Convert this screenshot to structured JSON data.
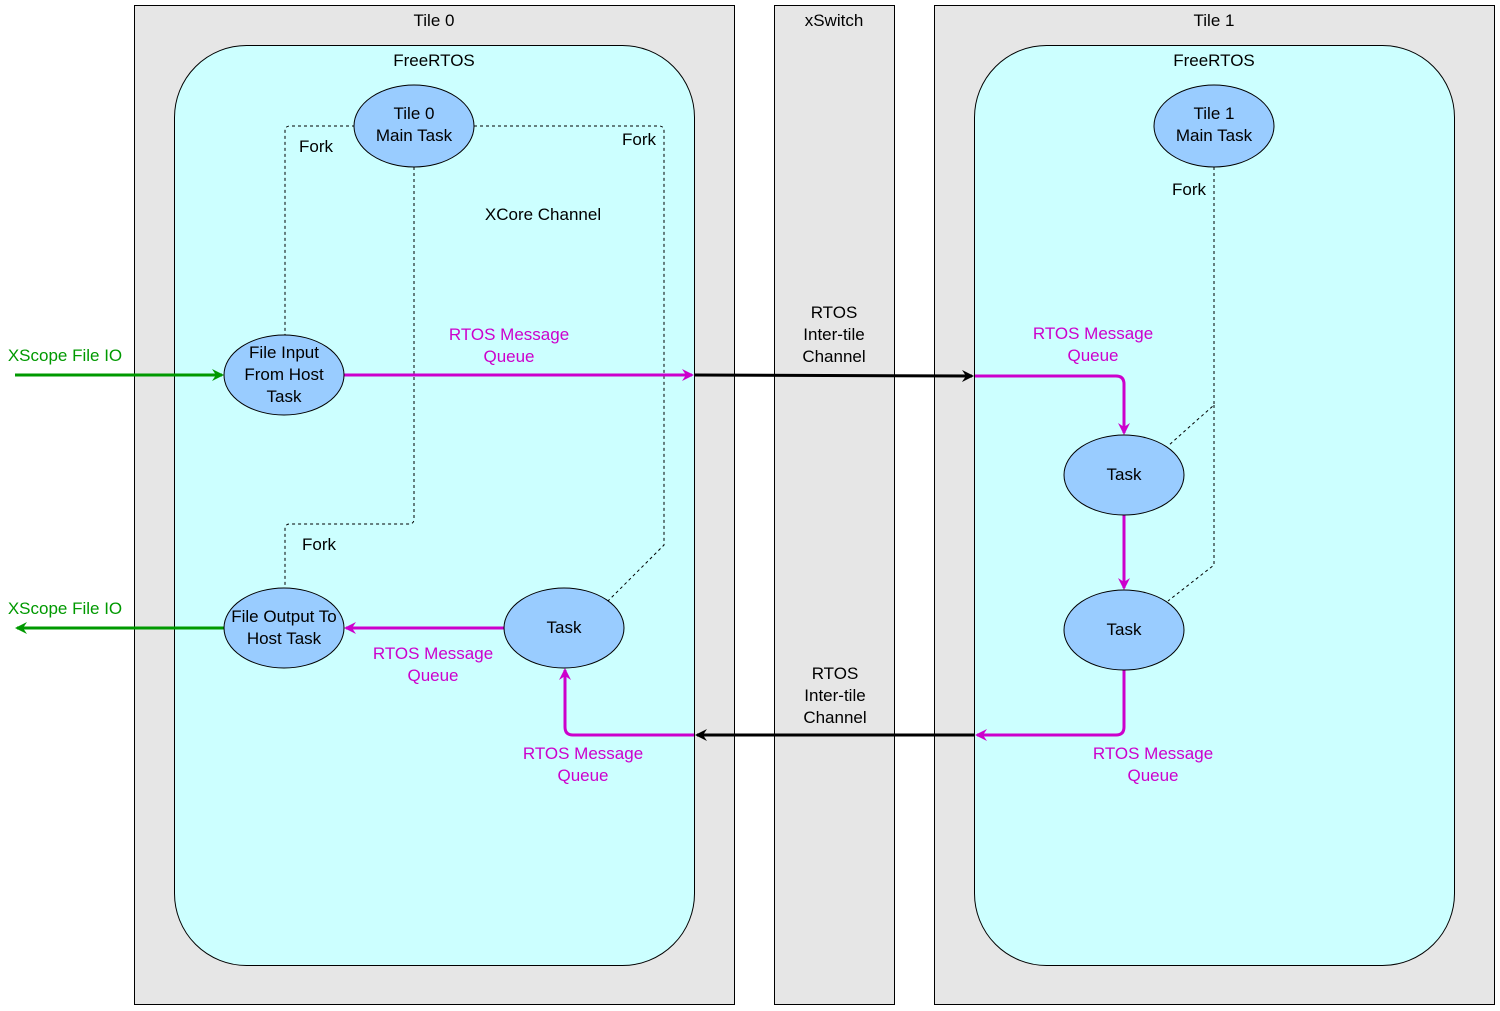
{
  "regions": {
    "tile0": {
      "title": "Tile 0",
      "os_label": "FreeRTOS"
    },
    "xswitch": {
      "title": "xSwitch"
    },
    "tile1": {
      "title": "Tile 1",
      "os_label": "FreeRTOS"
    }
  },
  "tasks": {
    "tile0_main": {
      "line1": "Tile 0",
      "line2": "Main Task"
    },
    "file_input": {
      "line1": "File Input",
      "line2": "From Host",
      "line3": "Task"
    },
    "file_output": {
      "line1": "File Output To",
      "line2": "Host Task"
    },
    "tile0_task": {
      "label": "Task"
    },
    "tile1_main": {
      "line1": "Tile 1",
      "line2": "Main Task"
    },
    "tile1_task_a": {
      "label": "Task"
    },
    "tile1_task_b": {
      "label": "Task"
    }
  },
  "labels": {
    "fork": "Fork",
    "xcore_channel": "XCore Channel",
    "xscope_in": "XScope File IO",
    "xscope_out": "XScope File IO",
    "mq_line1": "RTOS Message",
    "mq_line2": "Queue",
    "intertile_line1": "RTOS",
    "intertile_line2": "Inter-tile",
    "intertile_line3": "Channel"
  },
  "colors": {
    "panel": "#e6e6e6",
    "rtos_container": "#ccffff",
    "task_fill": "#99ccff",
    "message_queue": "#cc00cc",
    "xscope": "#009900",
    "channel": "#000000"
  }
}
